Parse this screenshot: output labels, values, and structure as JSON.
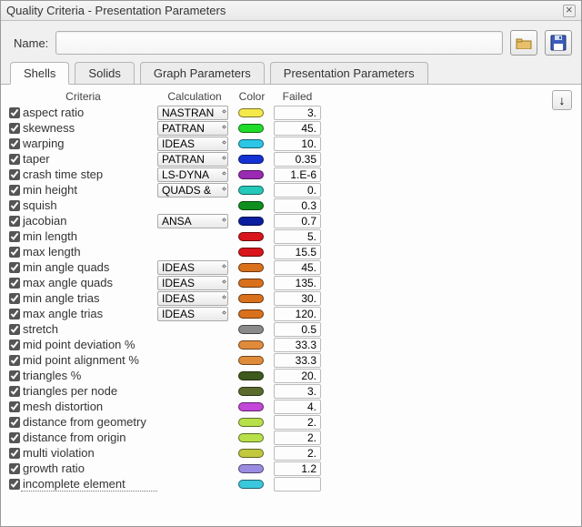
{
  "window": {
    "title": "Quality Criteria - Presentation Parameters"
  },
  "name_row": {
    "label": "Name:",
    "value": ""
  },
  "tabs": [
    {
      "label": "Shells",
      "active": true
    },
    {
      "label": "Solids",
      "active": false
    },
    {
      "label": "Graph Parameters",
      "active": false
    },
    {
      "label": "Presentation Parameters",
      "active": false
    }
  ],
  "headers": {
    "criteria": "Criteria",
    "calculation": "Calculation",
    "color": "Color",
    "failed": "Failed"
  },
  "criteria": [
    {
      "checked": true,
      "name": "aspect ratio",
      "calc": "NASTRAN",
      "color": "#f5e84a",
      "failed": "3."
    },
    {
      "checked": true,
      "name": "skewness",
      "calc": "PATRAN",
      "color": "#1fdc2a",
      "failed": "45."
    },
    {
      "checked": true,
      "name": "warping",
      "calc": "IDEAS",
      "color": "#2bc5e6",
      "failed": "10."
    },
    {
      "checked": true,
      "name": "taper",
      "calc": "PATRAN",
      "color": "#1432d4",
      "failed": "0.35"
    },
    {
      "checked": true,
      "name": "crash time step",
      "calc": "LS-DYNA",
      "color": "#9b2ab3",
      "failed": "1.E-6"
    },
    {
      "checked": true,
      "name": "min height",
      "calc": "QUADS &",
      "color": "#25c8b9",
      "failed": "0."
    },
    {
      "checked": true,
      "name": "squish",
      "calc": "",
      "color": "#0e8f1d",
      "failed": "0.3"
    },
    {
      "checked": true,
      "name": "jacobian",
      "calc": "ANSA",
      "color": "#0a1e9f",
      "failed": "0.7"
    },
    {
      "checked": true,
      "name": "min length",
      "calc": "",
      "color": "#d8151a",
      "failed": "5."
    },
    {
      "checked": true,
      "name": "max length",
      "calc": "",
      "color": "#d8151a",
      "failed": "15.5"
    },
    {
      "checked": true,
      "name": "min angle quads",
      "calc": "IDEAS",
      "color": "#d9701c",
      "failed": "45."
    },
    {
      "checked": true,
      "name": "max angle quads",
      "calc": "IDEAS",
      "color": "#d9701c",
      "failed": "135."
    },
    {
      "checked": true,
      "name": "min angle trias",
      "calc": "IDEAS",
      "color": "#d9701c",
      "failed": "30."
    },
    {
      "checked": true,
      "name": "max angle trias",
      "calc": "IDEAS",
      "color": "#d9701c",
      "failed": "120."
    },
    {
      "checked": true,
      "name": "stretch",
      "calc": "",
      "color": "#8a8a8a",
      "failed": "0.5"
    },
    {
      "checked": true,
      "name": "mid point deviation %",
      "calc": "",
      "color": "#e08b3b",
      "failed": "33.3"
    },
    {
      "checked": true,
      "name": "mid point alignment %",
      "calc": "",
      "color": "#e08b3b",
      "failed": "33.3"
    },
    {
      "checked": true,
      "name": "triangles %",
      "calc": "",
      "color": "#3d5a1c",
      "failed": "20."
    },
    {
      "checked": true,
      "name": "triangles per node",
      "calc": "",
      "color": "#5a6b2c",
      "failed": "3."
    },
    {
      "checked": true,
      "name": "mesh distortion",
      "calc": "",
      "color": "#c247d8",
      "failed": "4."
    },
    {
      "checked": true,
      "name": "distance from geometry",
      "calc": "",
      "color": "#b8e04a",
      "failed": "2."
    },
    {
      "checked": true,
      "name": "distance from origin",
      "calc": "",
      "color": "#b8e04a",
      "failed": "2."
    },
    {
      "checked": true,
      "name": "multi violation",
      "calc": "",
      "color": "#c2c83e",
      "failed": "2."
    },
    {
      "checked": true,
      "name": "growth ratio",
      "calc": "",
      "color": "#9b8be0",
      "failed": "1.2"
    },
    {
      "checked": true,
      "name": "incomplete element",
      "calc": "",
      "color": "#3bc8dc",
      "failed": ""
    }
  ]
}
